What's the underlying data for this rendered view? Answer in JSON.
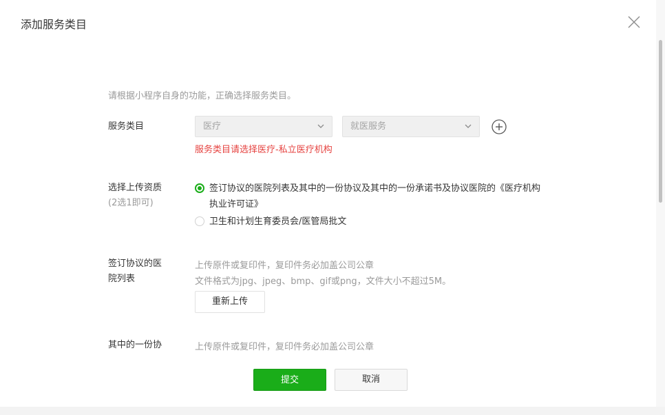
{
  "dialog": {
    "title": "添加服务类目",
    "close_icon": "close-icon"
  },
  "form": {
    "intro": "请根据小程序自身的功能，正确选择服务类目。",
    "category": {
      "label": "服务类目",
      "primary_value": "医疗",
      "secondary_value": "就医服务",
      "add_icon": "plus-circle-icon",
      "error": "服务类目请选择医疗-私立医疗机构"
    },
    "qualification": {
      "label": "选择上传资质",
      "sublabel": "(2选1即可)",
      "options": [
        {
          "label": "签订协议的医院列表及其中的一份协议及其中的一份承诺书及协议医院的《医疗机构执业许可证》",
          "selected": true
        },
        {
          "label": "卫生和计划生育委员会/医管局批文",
          "selected": false
        }
      ]
    },
    "hospital_list": {
      "label_line1": "签订协议的医",
      "label_line2": "院列表",
      "hint1": "上传原件或复印件，复印件务必加盖公司公章",
      "hint2": "文件格式为jpg、jpeg、bmp、gif或png，文件大小不超过5M。",
      "reupload_label": "重新上传"
    },
    "agreement": {
      "label": "其中的一份协",
      "hint1": "上传原件或复印件，复印件务必加盖公司公章"
    }
  },
  "footer": {
    "submit_label": "提交",
    "cancel_label": "取消"
  },
  "colors": {
    "accent": "#1aad19",
    "error": "#e64340",
    "muted_text": "#9a9a9a"
  }
}
